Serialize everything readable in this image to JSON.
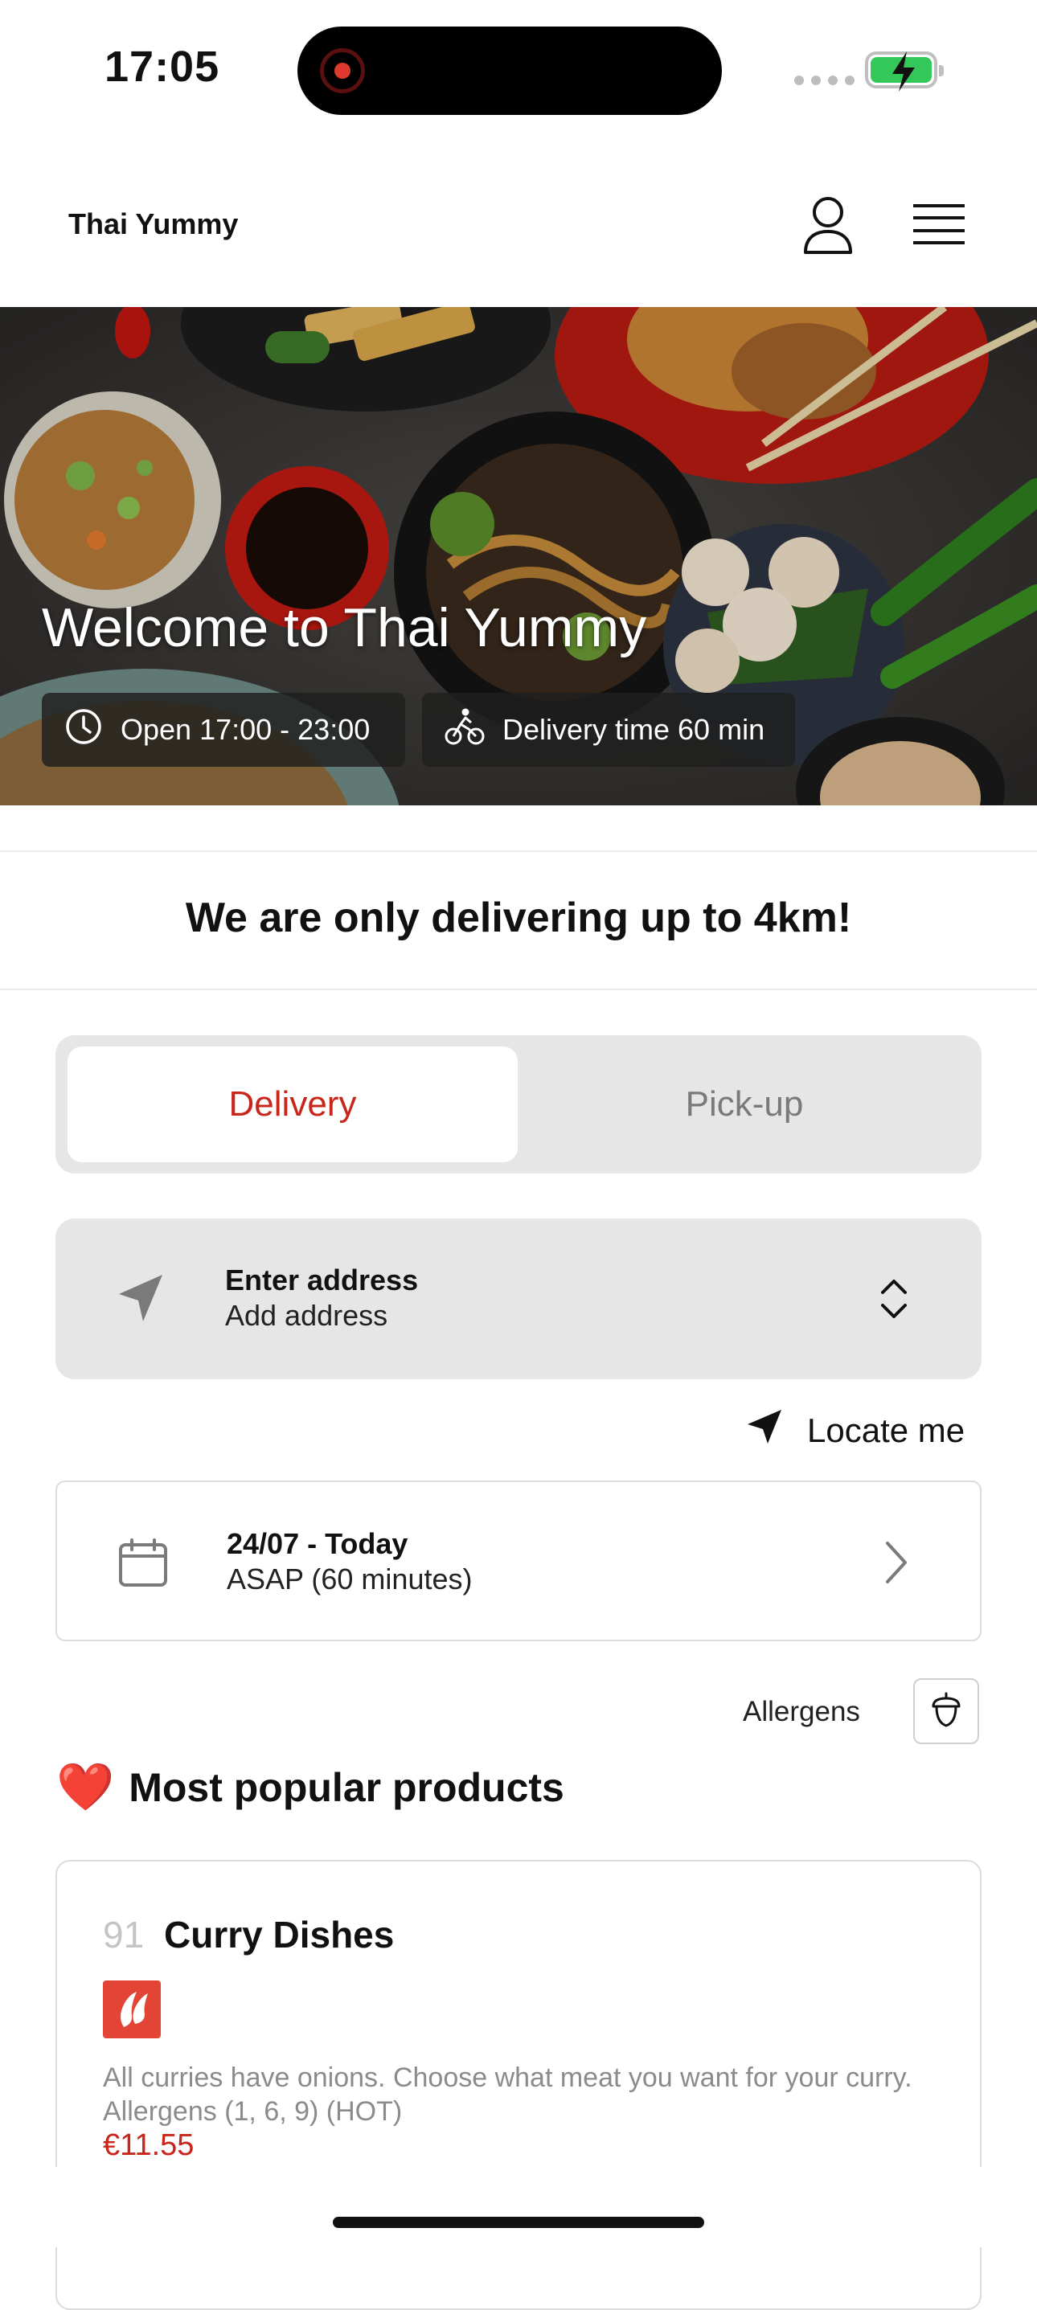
{
  "status_bar": {
    "time": "17:05",
    "battery_color": "#34c759",
    "recording_color": "#e03a2f"
  },
  "header": {
    "brand": "Thai Yummy",
    "icons": [
      "user-icon",
      "menu-icon"
    ]
  },
  "hero": {
    "title": "Welcome to Thai Yummy",
    "opening_hours": "Open 17:00 - 23:00",
    "delivery_time": "Delivery time 60 min",
    "icons": [
      "clock-icon",
      "bicycle-icon"
    ]
  },
  "notice": "We are only delivering up to 4km!",
  "order_mode": {
    "options": [
      "Delivery",
      "Pick-up"
    ],
    "selected": "Delivery",
    "accent": "#c8261b"
  },
  "address": {
    "label": "Enter address",
    "value": "Add address",
    "icons": [
      "navigation-arrow-icon",
      "chevron-up-down-icon"
    ]
  },
  "locate": {
    "label": "Locate me"
  },
  "schedule": {
    "date": "24/07 - Today",
    "time": "ASAP (60 minutes)"
  },
  "allergens": {
    "label": "Allergens"
  },
  "popular": {
    "emoji": "❤️",
    "title": "Most popular products"
  },
  "product": {
    "number": "91",
    "name": "Curry Dishes",
    "badge_icon": "chili-icon",
    "badge_color": "#e24535",
    "description": "All curries have onions. Choose what meat you want for your curry. Allergens (1, 6, 9) (HOT)",
    "price": "€11.55"
  }
}
